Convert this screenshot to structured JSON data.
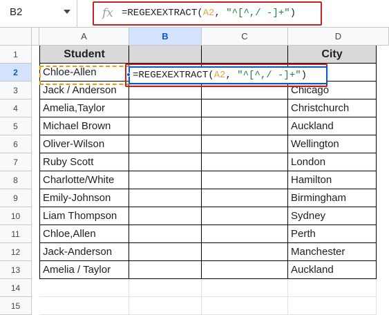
{
  "name_box": {
    "value": "B2"
  },
  "formula_bar": {
    "fx_label": "fx",
    "formula_prefix": "=REGEXEXTRACT(",
    "formula_ref": "A2",
    "formula_sep": ", ",
    "formula_str": "\"^[^,/ -]+\"",
    "formula_suffix": ")"
  },
  "columns": [
    "A",
    "B",
    "C",
    "D"
  ],
  "rows": [
    "1",
    "2",
    "3",
    "4",
    "5",
    "6",
    "7",
    "8",
    "9",
    "10",
    "11",
    "12",
    "13",
    "14",
    "15"
  ],
  "header": {
    "a": "Student",
    "b": "",
    "c": "",
    "d": "City"
  },
  "students": [
    "Chloe-Allen",
    "Jack / Anderson",
    "Amelia,Taylor",
    "Michael Brown",
    "Oliver-Wilson",
    "Ruby Scott",
    "Charlotte/White",
    "Emily-Johnson",
    "Liam Thompson",
    "Chloe,Allen",
    "Jack-Anderson",
    "Amelia / Taylor"
  ],
  "cities": [
    "",
    "Chicago",
    "Christchurch",
    "Auckland",
    "Wellington",
    "London",
    "Hamilton",
    "Birmingham",
    "Sydney",
    "Perth",
    "Manchester",
    "Auckland"
  ],
  "edit_cell": {
    "prefix": "=REGEXEXTRACT(",
    "ref": "A2",
    "sep": ", ",
    "str": "\"^[^,/ -]+\"",
    "suffix": ")"
  },
  "colors": {
    "selection": "#0b57d0",
    "highlight": "#c5221f",
    "marquee": "#f29900",
    "ref_token": "#e8a33d",
    "string_token": "#188038"
  }
}
